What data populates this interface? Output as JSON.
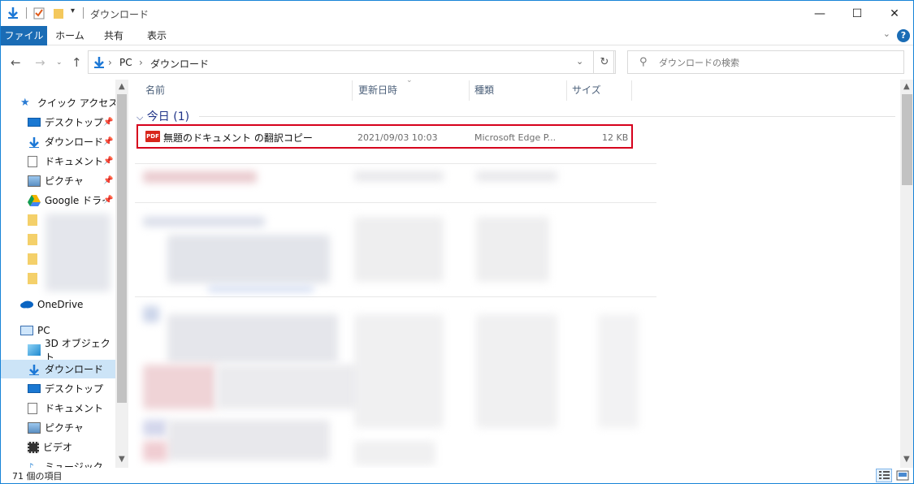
{
  "window": {
    "title": "ダウンロード",
    "buttons": {
      "minimize": "—",
      "maximize": "☐",
      "close": "✕"
    }
  },
  "ribbon": {
    "tabs": [
      "ファイル",
      "ホーム",
      "共有",
      "表示"
    ],
    "help": "?"
  },
  "address": {
    "crumbs": [
      "PC",
      "ダウンロード"
    ],
    "search_placeholder": "ダウンロードの検索"
  },
  "nav": {
    "quick_access": "クイック アクセス",
    "quick_items": [
      "デスクトップ",
      "ダウンロード",
      "ドキュメント",
      "ピクチャ",
      "Google ドライブ"
    ],
    "onedrive": "OneDrive",
    "pc": "PC",
    "pc_items": [
      "3D オブジェクト",
      "ダウンロード",
      "デスクトップ",
      "ドキュメント",
      "ピクチャ",
      "ビデオ",
      "ミュージック"
    ]
  },
  "columns": [
    "名前",
    "更新日時",
    "種類",
    "サイズ"
  ],
  "group": {
    "label": "今日 (1)"
  },
  "file": {
    "name": "無題のドキュメント の翻訳コピー",
    "modified": "2021/09/03 10:03",
    "type": "Microsoft Edge P...",
    "size": "12 KB",
    "icon_label": "PDF"
  },
  "status": {
    "count": "71 個の項目"
  }
}
